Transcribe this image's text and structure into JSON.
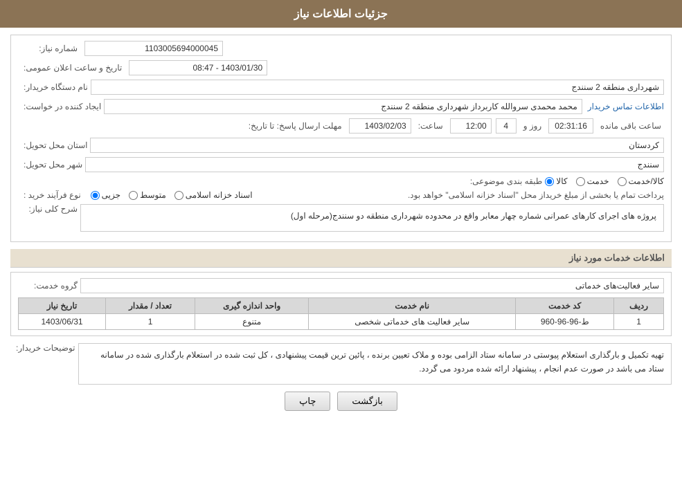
{
  "header": {
    "title": "جزئیات اطلاعات نیاز"
  },
  "form": {
    "شماره_نیاز_label": "شماره نیاز:",
    "شماره_نیاز_value": "1103005694000045",
    "تاریخ_label": "تاریخ و ساعت اعلان عمومی:",
    "تاریخ_value": "1403/01/30 - 08:47",
    "نام_دستگاه_label": "نام دستگاه خریدار:",
    "نام_دستگاه_value": "شهرداری منطقه 2 سنندج",
    "ایجاد_label": "ایجاد کننده در خواست:",
    "ایجاد_value": "محمد محمدی سروالله کاربرداز شهرداری منطقه 2 سنندج",
    "تماس_link": "اطلاعات تماس خریدار",
    "مهلت_label": "مهلت ارسال پاسخ: تا تاریخ:",
    "مهلت_date": "1403/02/03",
    "مهلت_ساعت_label": "ساعت:",
    "مهلت_ساعت": "12:00",
    "مهلت_روز_label": "روز و",
    "مهلت_روز": "4",
    "باقی_مانده_label": "ساعت باقی مانده",
    "باقی_مانده_value": "02:31:16",
    "استان_label": "استان محل تحویل:",
    "استان_value": "کردستان",
    "شهر_label": "شهر محل تحویل:",
    "شهر_value": "سنندج",
    "طبقه_label": "طبقه بندی موضوعی:",
    "نوع_فرآیند_label": "نوع فرآیند خرید :",
    "radio_options": [
      "کالا",
      "خدمت",
      "کالا/خدمت"
    ],
    "radio_selected": "کالا",
    "process_options": [
      "جزیی",
      "متوسط",
      "اسناد خزانه اسلامی"
    ],
    "process_note": "پرداخت تمام یا بخشی از مبلغ خریداز محل \"اسناد خزانه اسلامی\" خواهد بود.",
    "شرح_label": "شرح کلی نیاز:",
    "شرح_value": "پروژه های اجرای کارهای عمرانی شماره چهار معابر واقع در محدوده شهرداری منطقه دو سنندج(مرحله اول)"
  },
  "services_section": {
    "title": "اطلاعات خدمات مورد نیاز",
    "گروه_label": "گروه خدمت:",
    "گروه_value": "سایر فعالیت‌های خدماتی",
    "table": {
      "headers": [
        "ردیف",
        "کد خدمت",
        "نام خدمت",
        "واحد اندازه گیری",
        "تعداد / مقدار",
        "تاریخ نیاز"
      ],
      "rows": [
        {
          "ردیف": "1",
          "کد_خدمت": "ط-96-96-960",
          "نام_خدمت": "سایر فعالیت های خدماتی شخصی",
          "واحد": "متنوع",
          "تعداد": "1",
          "تاریخ": "1403/06/31"
        }
      ]
    }
  },
  "notes": {
    "label": "توضیحات خریدار:",
    "text": "تهیه  تکمیل و بارگذاری استعلام پیوستی در سامانه ستاد الزامی بوده و ملاک تعیین برنده ، پائین ترین قیمت پیشنهادی ، کل ثبت شده در استعلام بارگذاری شده در سامانه ستاد می باشد در صورت عدم انجام ، پیشنهاد ارائه شده مردود می گردد."
  },
  "buttons": {
    "back": "بازگشت",
    "print": "چاپ"
  }
}
